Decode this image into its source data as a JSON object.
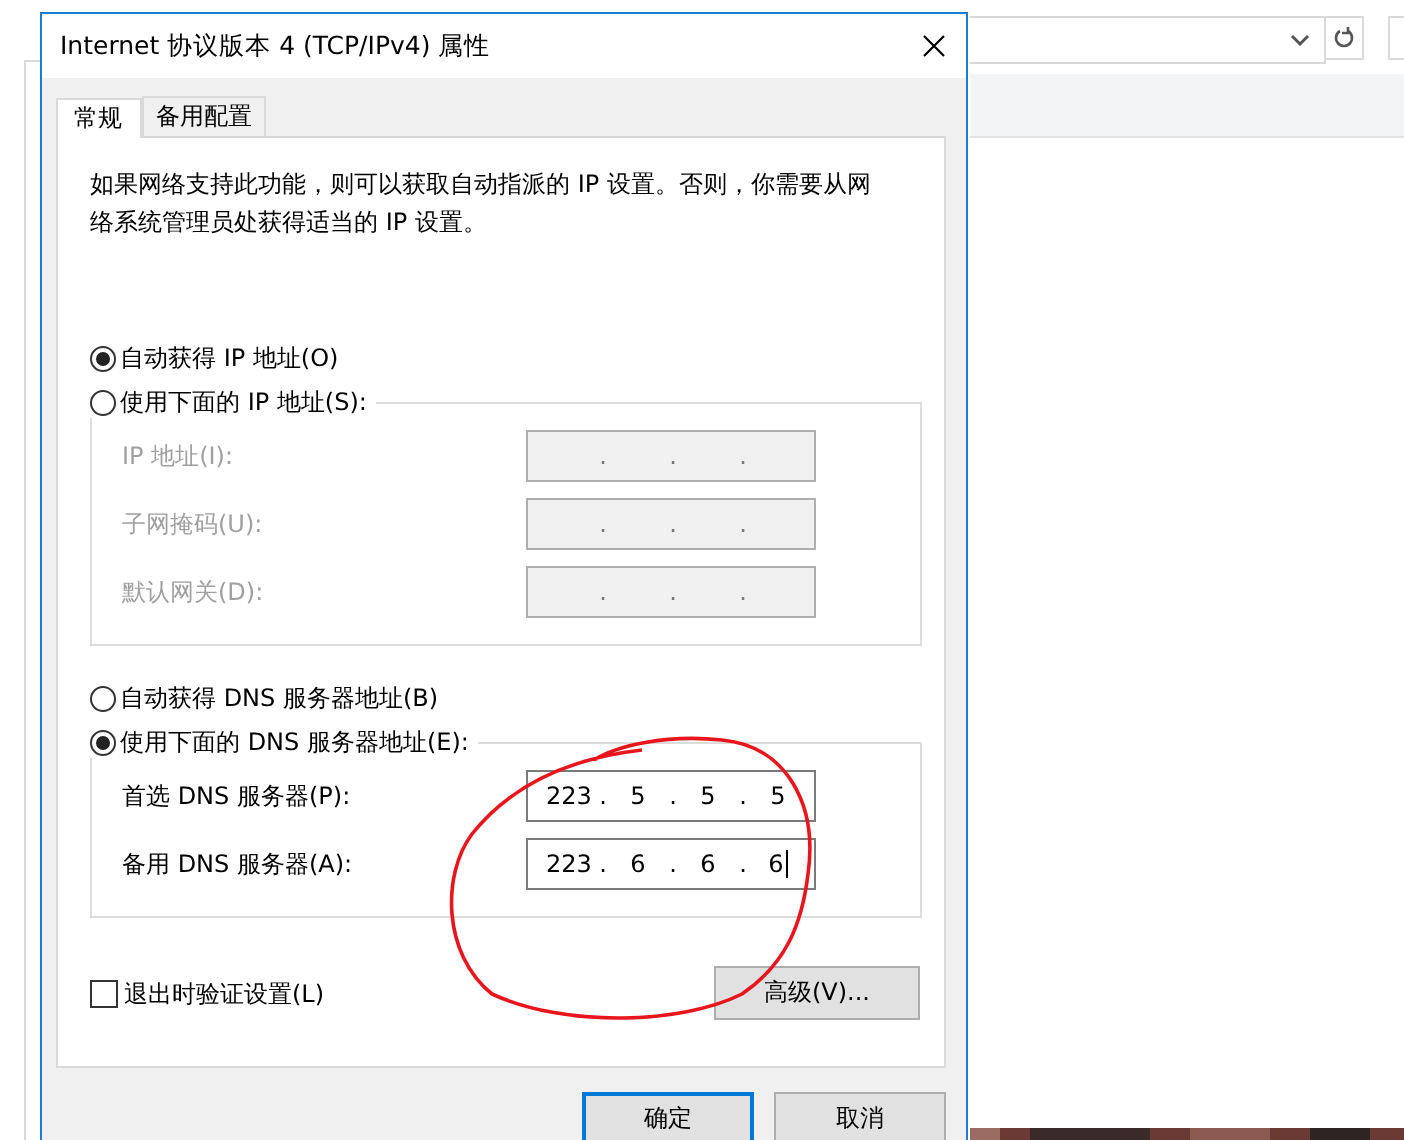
{
  "dialog": {
    "title": "Internet 协议版本 4 (TCP/IPv4) 属性"
  },
  "tabs": [
    {
      "label": "常规",
      "selected": true
    },
    {
      "label": "备用配置",
      "selected": false
    }
  ],
  "description": "如果网络支持此功能，则可以获取自动指派的 IP 设置。否则，你需要从网络系统管理员处获得适当的 IP 设置。",
  "ip_auto": {
    "label": "自动获得 IP 地址(O)",
    "selected": true
  },
  "ip_manual": {
    "label": "使用下面的 IP 地址(S):",
    "selected": false
  },
  "ip_fields": [
    {
      "label": "IP 地址(I):",
      "disabled": true,
      "focused": false,
      "dots": [
        ".",
        ".",
        "."
      ]
    },
    {
      "label": "子网掩码(U):",
      "disabled": true,
      "focused": false,
      "dots": [
        ".",
        ".",
        "."
      ]
    },
    {
      "label": "默认网关(D):",
      "disabled": true,
      "focused": false,
      "dots": [
        ".",
        ".",
        "."
      ]
    }
  ],
  "dns_auto": {
    "label": "自动获得 DNS 服务器地址(B)",
    "selected": false
  },
  "dns_manual": {
    "label": "使用下面的 DNS 服务器地址(E):",
    "selected": true
  },
  "dns_fields": [
    {
      "label": "首选 DNS 服务器(P):",
      "disabled": false,
      "focused": false,
      "octets": [
        "223",
        "5",
        "5",
        "5"
      ],
      "dots": [
        ".",
        ".",
        "."
      ]
    },
    {
      "label": "备用 DNS 服务器(A):",
      "disabled": false,
      "focused": true,
      "octets": [
        "223",
        "6",
        "6",
        "6"
      ],
      "dots": [
        ".",
        ".",
        "."
      ]
    }
  ],
  "validate_on_exit": {
    "label": "退出时验证设置(L)",
    "checked": false
  },
  "advanced_button": "高级(V)...",
  "buttons": [
    {
      "label": "确定",
      "default": true
    },
    {
      "label": "取消",
      "default": false
    }
  ]
}
